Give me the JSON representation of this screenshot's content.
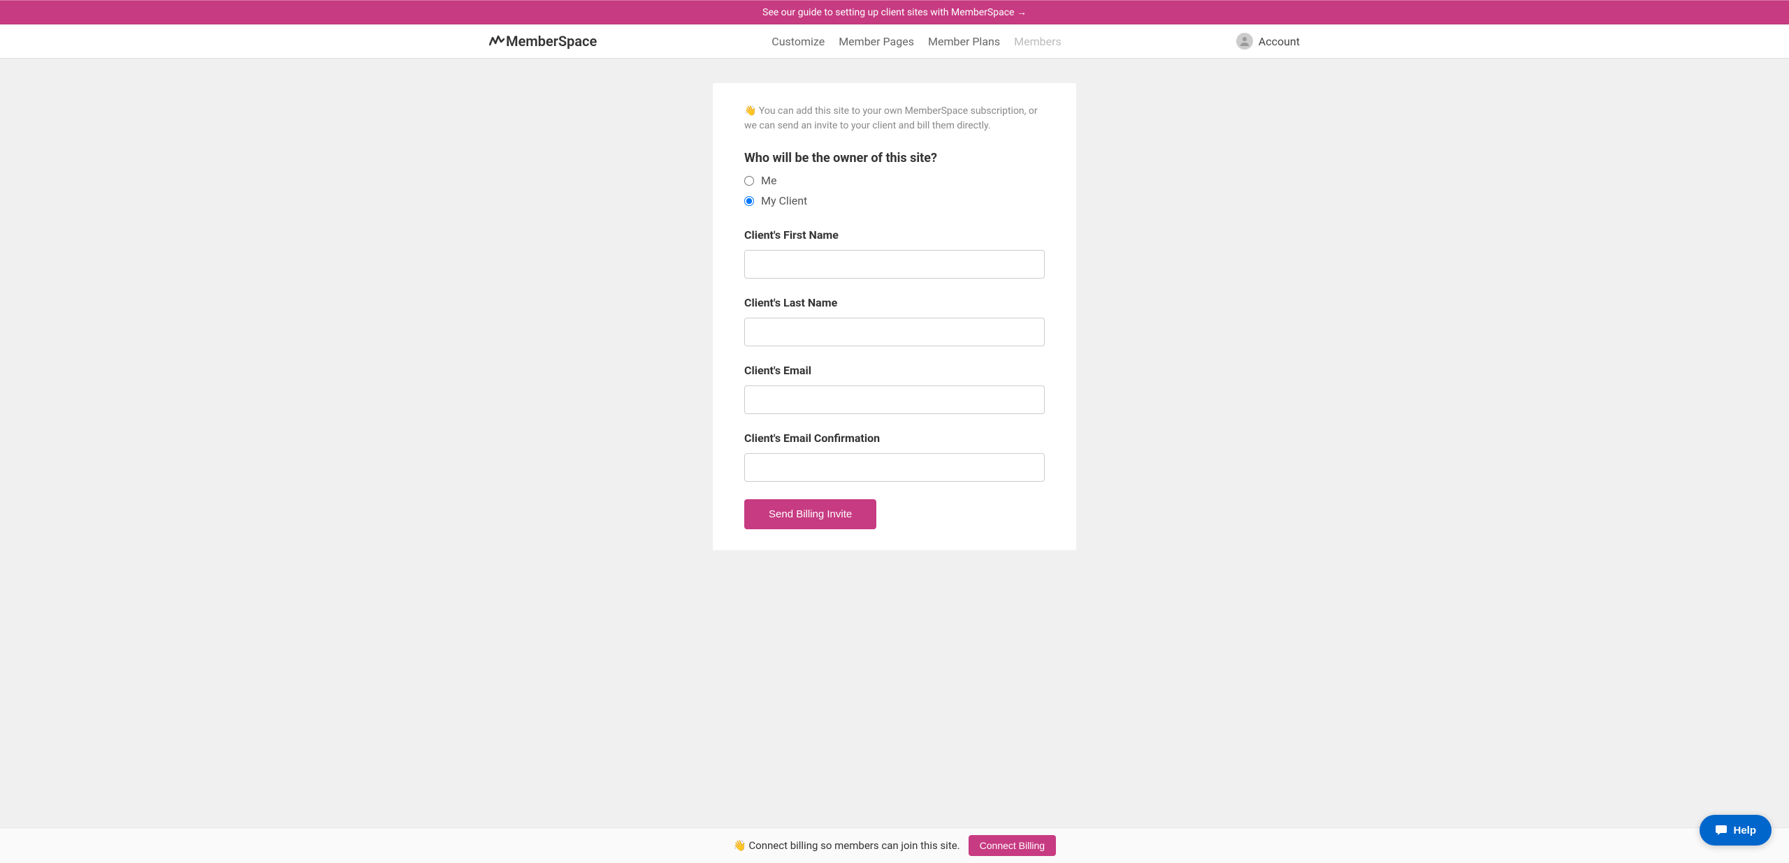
{
  "banner": {
    "text": "See our guide to setting up client sites with MemberSpace →"
  },
  "header": {
    "logo": "MemberSpace",
    "nav": {
      "customize": "Customize",
      "member_pages": "Member Pages",
      "member_plans": "Member Plans",
      "members": "Members"
    },
    "account_label": "Account"
  },
  "form": {
    "intro_emoji": "👋",
    "intro_text": " You can add this site to your own MemberSpace subscription, or we can send an invite to your client and bill them directly.",
    "owner_question": "Who will be the owner of this site?",
    "radio_me": "Me",
    "radio_client": "My Client",
    "first_name_label": "Client's First Name",
    "last_name_label": "Client's Last Name",
    "email_label": "Client's Email",
    "email_confirm_label": "Client's Email Confirmation",
    "submit_label": "Send Billing Invite"
  },
  "bottom_bar": {
    "emoji": "👋",
    "text": " Connect billing so members can join this site.",
    "button_label": "Connect Billing"
  },
  "help": {
    "label": "Help"
  }
}
